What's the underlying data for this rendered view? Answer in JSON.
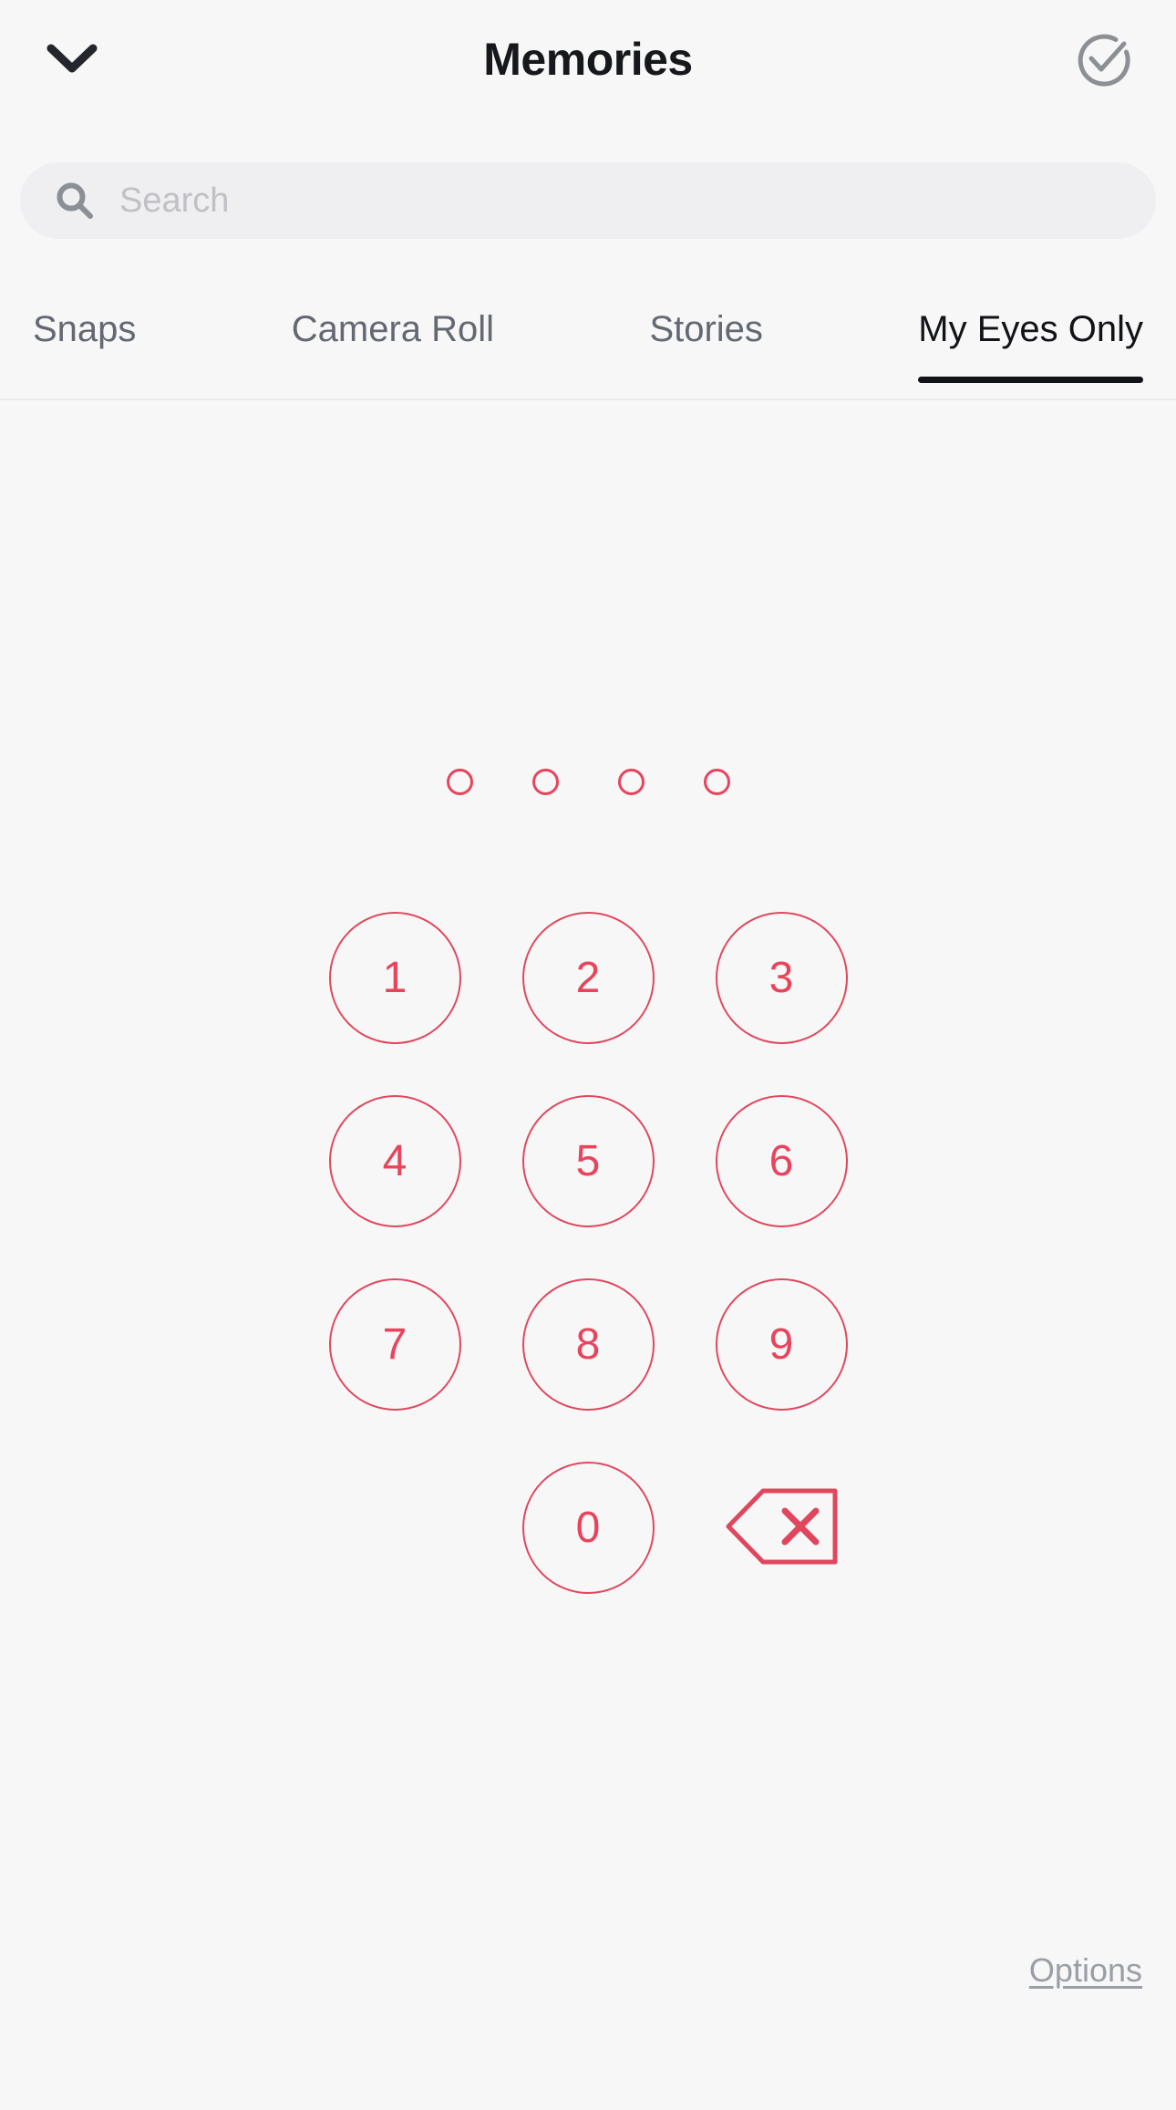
{
  "header": {
    "title": "Memories",
    "back_icon": "chevron-down-icon",
    "select_icon": "check-circle-icon"
  },
  "search": {
    "placeholder": "Search",
    "value": "",
    "icon": "search-icon"
  },
  "tabs": [
    {
      "label": "Snaps",
      "active": false
    },
    {
      "label": "Camera Roll",
      "active": false
    },
    {
      "label": "Stories",
      "active": false
    },
    {
      "label": "My Eyes Only",
      "active": true
    }
  ],
  "passcode": {
    "dots": [
      {
        "filled": false
      },
      {
        "filled": false
      },
      {
        "filled": false
      },
      {
        "filled": false
      }
    ],
    "entered_length": 0,
    "max_length": 4
  },
  "keypad": {
    "rows": [
      [
        "1",
        "2",
        "3"
      ],
      [
        "4",
        "5",
        "6"
      ],
      [
        "7",
        "8",
        "9"
      ]
    ],
    "zero": "0",
    "backspace_icon": "backspace-delete-icon"
  },
  "footer": {
    "options_label": "Options"
  },
  "colors": {
    "background": "#f7f7f8",
    "accent_red": "#e8455c",
    "text_dark": "#16181c",
    "text_muted": "#636871",
    "search_bg": "#efeff1",
    "placeholder": "#bfc1c6",
    "options_gray": "#9a9ea5"
  }
}
